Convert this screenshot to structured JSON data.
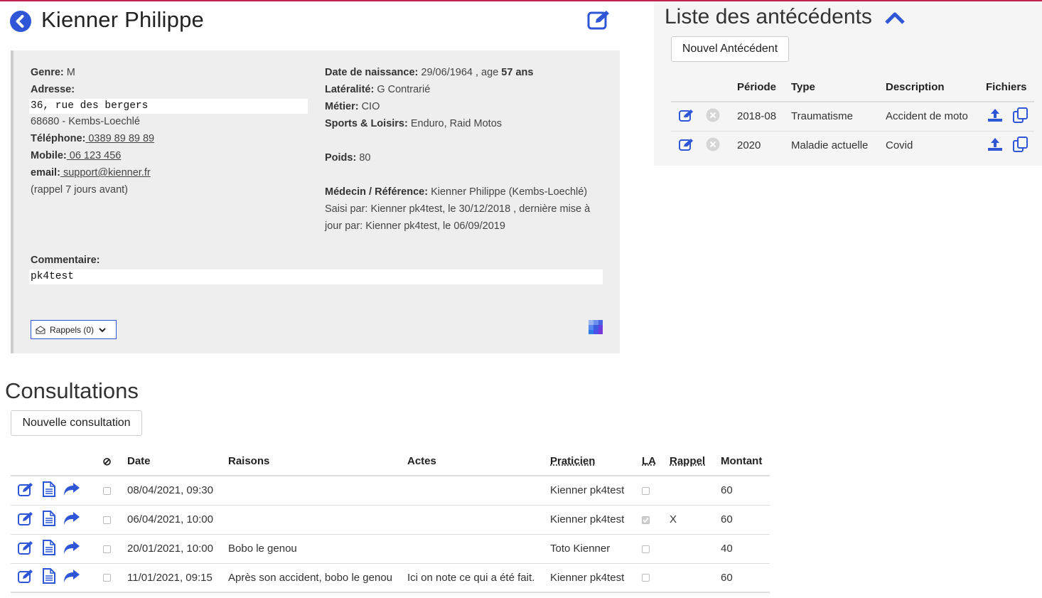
{
  "patient": {
    "name": "Kienner Philippe",
    "genre_label": "Genre:",
    "genre": " M",
    "adresse_label": "Adresse:",
    "adresse_line1": "36, rue des bergers",
    "adresse_line2": "68680 - Kembs-Loechlé",
    "telephone_label": "Téléphone:",
    "telephone": " 0389 89 89 89",
    "mobile_label": "Mobile:",
    "mobile": " 06 123 456",
    "email_label": "email:",
    "email": " support@kienner.fr",
    "rappel_note": "(rappel 7 jours avant)",
    "naissance_label": "Date de naissance:",
    "naissance": " 29/06/1964 , age ",
    "age": "57 ans",
    "lateralite_label": "Latéralité:",
    "lateralite": " G Contrarié",
    "metier_label": "Métier:",
    "metier": " CIO",
    "sports_label": "Sports & Loisirs:",
    "sports": " Enduro, Raid Motos",
    "poids_label": "Poids:",
    "poids": " 80",
    "medecin_label": "Médecin / Référence:",
    "medecin": " Kienner Philippe (Kembs-Loechlé)",
    "saisi_line1": "Saisi par: Kienner pk4test, le 30/12/2018 , dernière mise à",
    "saisi_line2": "jour par: Kienner pk4test, le 06/09/2019",
    "commentaire_label": "Commentaire:",
    "commentaire": "pk4test",
    "rappels_button": "Rappels (0)"
  },
  "antecedents": {
    "title": "Liste des antécédents",
    "new_button": "Nouvel Antécédent",
    "headers": {
      "periode": "Période",
      "type": "Type",
      "description": "Description",
      "fichiers": "Fichiers"
    },
    "rows": [
      {
        "periode": "2018-08",
        "type": "Traumatisme",
        "description": "Accident de moto"
      },
      {
        "periode": "2020",
        "type": "Maladie actuelle",
        "description": "Covid"
      }
    ]
  },
  "consultations": {
    "title": "Consultations",
    "new_button": "Nouvelle consultation",
    "headers": {
      "cancel_symbol": "⊘",
      "date": "Date",
      "raisons": "Raisons",
      "actes": "Actes",
      "praticien": "Praticien",
      "la": "LA",
      "rappel": "Rappel",
      "montant": "Montant"
    },
    "rows": [
      {
        "date": "08/04/2021, 09:30",
        "raisons": "",
        "actes": "",
        "praticien": "Kienner pk4test",
        "la_checked": false,
        "rappel": "",
        "montant": "60"
      },
      {
        "date": "06/04/2021, 10:00",
        "raisons": "",
        "actes": "",
        "praticien": "Kienner pk4test",
        "la_checked": true,
        "rappel": "X",
        "montant": "60"
      },
      {
        "date": "20/01/2021, 10:00",
        "raisons": "Bobo le genou",
        "actes": "",
        "praticien": "Toto Kienner",
        "la_checked": false,
        "rappel": "",
        "montant": "40"
      },
      {
        "date": "11/01/2021, 09:15",
        "raisons": "Après son accident, bobo le genou",
        "actes": "Ici on note ce qui a été fait.",
        "praticien": "Kienner pk4test",
        "la_checked": false,
        "rappel": "",
        "montant": "60"
      }
    ]
  },
  "colors": {
    "accent": "#2f56d6",
    "topbar": "#c0234f",
    "card_bg": "#eeeeee"
  }
}
